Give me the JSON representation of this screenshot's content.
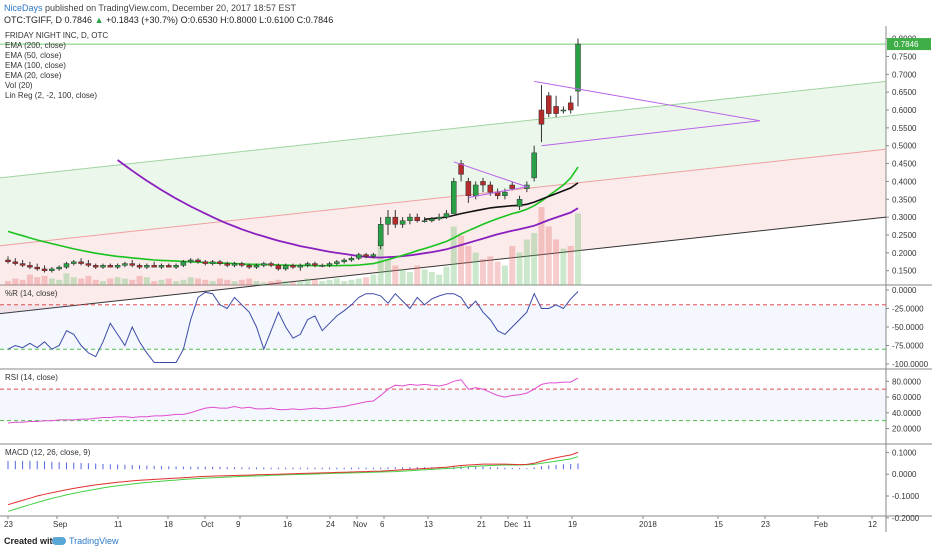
{
  "header": {
    "user": "NiceDays",
    "published": "published on TradingView.com, December 20, 2017 18:57 EST",
    "symbol": "OTC:TGIFF, D",
    "last": "0.7846",
    "change": "+0.1843 (+30.7%)",
    "ohlc": "O:0.6530 H:0.8000 L:0.6100 C:0.7846"
  },
  "legend": {
    "title": "FRIDAY NIGHT INC, D, OTC",
    "lines": [
      "EMA (200, close)",
      "EMA (50, close)",
      "EMA (100, close)",
      "EMA (20, close)",
      "Vol (20)",
      "Lin Reg (2, -2, 100, close)"
    ]
  },
  "price_axis": {
    "ticks": [
      "0.8000",
      "0.7500",
      "0.7000",
      "0.6500",
      "0.6000",
      "0.5500",
      "0.5000",
      "0.4500",
      "0.4000",
      "0.3500",
      "0.3000",
      "0.2500",
      "0.2000",
      "0.1500"
    ],
    "last_badge": "0.7846"
  },
  "panels": {
    "wr": {
      "title": "%R (14, close)",
      "ticks": [
        "0.0000",
        "-25.0000",
        "-50.0000",
        "-75.0000",
        "-100.0000"
      ]
    },
    "rsi": {
      "title": "RSI (14, close)",
      "ticks": [
        "80.0000",
        "60.0000",
        "40.0000",
        "20.0000"
      ]
    },
    "macd": {
      "title": "MACD (12, 26, close, 9)",
      "ticks": [
        "0.1000",
        "0.0000",
        "-0.1000",
        "-0.2000"
      ]
    }
  },
  "time_axis": [
    "23",
    "Sep",
    "11",
    "18",
    "Oct",
    "9",
    "16",
    "24",
    "Nov",
    "6",
    "13",
    "21",
    "Dec",
    "11",
    "19",
    "2018",
    "15",
    "23",
    "Feb",
    "12"
  ],
  "footer": {
    "created": "Created with",
    "brand": "TradingView"
  },
  "colors": {
    "up": "#2aa046",
    "down": "#b52a2a",
    "ema50": "#19c31e",
    "ema100": "#8a1fbf",
    "ema20": "#111111",
    "wr": "#3d4ba8",
    "rsi": "#e14fd0",
    "macd": "#e03030",
    "signal": "#44d044",
    "hist": "#5565e0",
    "badge": "#3fae49"
  },
  "chart_data": {
    "type": "candlestick",
    "title": "FRIDAY NIGHT INC, D, OTC",
    "ylim": [
      0.11,
      0.81
    ],
    "candles": [
      {
        "o": 0.18,
        "h": 0.19,
        "l": 0.17,
        "c": 0.175
      },
      {
        "o": 0.175,
        "h": 0.185,
        "l": 0.165,
        "c": 0.17
      },
      {
        "o": 0.17,
        "h": 0.18,
        "l": 0.16,
        "c": 0.165
      },
      {
        "o": 0.165,
        "h": 0.175,
        "l": 0.155,
        "c": 0.16
      },
      {
        "o": 0.16,
        "h": 0.17,
        "l": 0.15,
        "c": 0.155
      },
      {
        "o": 0.155,
        "h": 0.165,
        "l": 0.145,
        "c": 0.15
      },
      {
        "o": 0.15,
        "h": 0.16,
        "l": 0.145,
        "c": 0.155
      },
      {
        "o": 0.155,
        "h": 0.165,
        "l": 0.15,
        "c": 0.16
      },
      {
        "o": 0.16,
        "h": 0.175,
        "l": 0.155,
        "c": 0.17
      },
      {
        "o": 0.17,
        "h": 0.18,
        "l": 0.165,
        "c": 0.175
      },
      {
        "o": 0.175,
        "h": 0.185,
        "l": 0.165,
        "c": 0.17
      },
      {
        "o": 0.17,
        "h": 0.18,
        "l": 0.16,
        "c": 0.165
      },
      {
        "o": 0.165,
        "h": 0.17,
        "l": 0.155,
        "c": 0.16
      },
      {
        "o": 0.16,
        "h": 0.17,
        "l": 0.155,
        "c": 0.165
      },
      {
        "o": 0.165,
        "h": 0.17,
        "l": 0.16,
        "c": 0.16
      },
      {
        "o": 0.16,
        "h": 0.17,
        "l": 0.155,
        "c": 0.165
      },
      {
        "o": 0.165,
        "h": 0.175,
        "l": 0.16,
        "c": 0.17
      },
      {
        "o": 0.17,
        "h": 0.18,
        "l": 0.16,
        "c": 0.165
      },
      {
        "o": 0.165,
        "h": 0.17,
        "l": 0.155,
        "c": 0.16
      },
      {
        "o": 0.16,
        "h": 0.17,
        "l": 0.155,
        "c": 0.165
      },
      {
        "o": 0.165,
        "h": 0.175,
        "l": 0.16,
        "c": 0.16
      },
      {
        "o": 0.16,
        "h": 0.17,
        "l": 0.155,
        "c": 0.165
      },
      {
        "o": 0.165,
        "h": 0.17,
        "l": 0.16,
        "c": 0.16
      },
      {
        "o": 0.16,
        "h": 0.17,
        "l": 0.155,
        "c": 0.165
      },
      {
        "o": 0.165,
        "h": 0.18,
        "l": 0.16,
        "c": 0.175
      },
      {
        "o": 0.175,
        "h": 0.185,
        "l": 0.17,
        "c": 0.18
      },
      {
        "o": 0.18,
        "h": 0.185,
        "l": 0.17,
        "c": 0.175
      },
      {
        "o": 0.175,
        "h": 0.18,
        "l": 0.165,
        "c": 0.17
      },
      {
        "o": 0.17,
        "h": 0.18,
        "l": 0.165,
        "c": 0.175
      },
      {
        "o": 0.175,
        "h": 0.18,
        "l": 0.165,
        "c": 0.17
      },
      {
        "o": 0.17,
        "h": 0.175,
        "l": 0.16,
        "c": 0.165
      },
      {
        "o": 0.165,
        "h": 0.175,
        "l": 0.16,
        "c": 0.17
      },
      {
        "o": 0.17,
        "h": 0.175,
        "l": 0.16,
        "c": 0.165
      },
      {
        "o": 0.165,
        "h": 0.17,
        "l": 0.155,
        "c": 0.16
      },
      {
        "o": 0.16,
        "h": 0.17,
        "l": 0.155,
        "c": 0.165
      },
      {
        "o": 0.165,
        "h": 0.175,
        "l": 0.16,
        "c": 0.17
      },
      {
        "o": 0.17,
        "h": 0.175,
        "l": 0.16,
        "c": 0.165
      },
      {
        "o": 0.165,
        "h": 0.17,
        "l": 0.15,
        "c": 0.155
      },
      {
        "o": 0.155,
        "h": 0.17,
        "l": 0.15,
        "c": 0.165
      },
      {
        "o": 0.165,
        "h": 0.17,
        "l": 0.155,
        "c": 0.16
      },
      {
        "o": 0.16,
        "h": 0.17,
        "l": 0.15,
        "c": 0.165
      },
      {
        "o": 0.165,
        "h": 0.175,
        "l": 0.16,
        "c": 0.17
      },
      {
        "o": 0.17,
        "h": 0.175,
        "l": 0.16,
        "c": 0.165
      },
      {
        "o": 0.165,
        "h": 0.17,
        "l": 0.16,
        "c": 0.165
      },
      {
        "o": 0.165,
        "h": 0.175,
        "l": 0.16,
        "c": 0.17
      },
      {
        "o": 0.17,
        "h": 0.18,
        "l": 0.165,
        "c": 0.175
      },
      {
        "o": 0.175,
        "h": 0.185,
        "l": 0.17,
        "c": 0.18
      },
      {
        "o": 0.18,
        "h": 0.19,
        "l": 0.175,
        "c": 0.185
      },
      {
        "o": 0.185,
        "h": 0.2,
        "l": 0.18,
        "c": 0.195
      },
      {
        "o": 0.195,
        "h": 0.2,
        "l": 0.185,
        "c": 0.19
      },
      {
        "o": 0.19,
        "h": 0.2,
        "l": 0.185,
        "c": 0.195
      },
      {
        "o": 0.22,
        "h": 0.3,
        "l": 0.21,
        "c": 0.28
      },
      {
        "o": 0.28,
        "h": 0.32,
        "l": 0.25,
        "c": 0.3
      },
      {
        "o": 0.3,
        "h": 0.32,
        "l": 0.27,
        "c": 0.28
      },
      {
        "o": 0.28,
        "h": 0.3,
        "l": 0.27,
        "c": 0.29
      },
      {
        "o": 0.29,
        "h": 0.31,
        "l": 0.28,
        "c": 0.3
      },
      {
        "o": 0.3,
        "h": 0.31,
        "l": 0.285,
        "c": 0.29
      },
      {
        "o": 0.29,
        "h": 0.3,
        "l": 0.285,
        "c": 0.29
      },
      {
        "o": 0.29,
        "h": 0.3,
        "l": 0.285,
        "c": 0.295
      },
      {
        "o": 0.295,
        "h": 0.31,
        "l": 0.29,
        "c": 0.3
      },
      {
        "o": 0.3,
        "h": 0.32,
        "l": 0.295,
        "c": 0.31
      },
      {
        "o": 0.31,
        "h": 0.41,
        "l": 0.31,
        "c": 0.4
      },
      {
        "o": 0.45,
        "h": 0.46,
        "l": 0.4,
        "c": 0.42
      },
      {
        "o": 0.4,
        "h": 0.41,
        "l": 0.34,
        "c": 0.36
      },
      {
        "o": 0.36,
        "h": 0.4,
        "l": 0.35,
        "c": 0.39
      },
      {
        "o": 0.4,
        "h": 0.41,
        "l": 0.37,
        "c": 0.39
      },
      {
        "o": 0.39,
        "h": 0.4,
        "l": 0.36,
        "c": 0.37
      },
      {
        "o": 0.37,
        "h": 0.38,
        "l": 0.35,
        "c": 0.36
      },
      {
        "o": 0.36,
        "h": 0.38,
        "l": 0.35,
        "c": 0.37
      },
      {
        "o": 0.39,
        "h": 0.4,
        "l": 0.375,
        "c": 0.38
      },
      {
        "o": 0.33,
        "h": 0.36,
        "l": 0.32,
        "c": 0.35
      },
      {
        "o": 0.38,
        "h": 0.4,
        "l": 0.37,
        "c": 0.39
      },
      {
        "o": 0.41,
        "h": 0.5,
        "l": 0.4,
        "c": 0.48
      },
      {
        "o": 0.6,
        "h": 0.67,
        "l": 0.51,
        "c": 0.56
      },
      {
        "o": 0.64,
        "h": 0.65,
        "l": 0.58,
        "c": 0.59
      },
      {
        "o": 0.61,
        "h": 0.64,
        "l": 0.58,
        "c": 0.59
      },
      {
        "o": 0.6,
        "h": 0.61,
        "l": 0.59,
        "c": 0.6
      },
      {
        "o": 0.62,
        "h": 0.64,
        "l": 0.59,
        "c": 0.6
      },
      {
        "o": 0.653,
        "h": 0.8,
        "l": 0.61,
        "c": 0.7846
      }
    ],
    "ema50": [
      0.26,
      0.254,
      0.248,
      0.242,
      0.236,
      0.231,
      0.226,
      0.221,
      0.216,
      0.211,
      0.207,
      0.203,
      0.199,
      0.196,
      0.193,
      0.19,
      0.188,
      0.186,
      0.184,
      0.182,
      0.18,
      0.179,
      0.178,
      0.177,
      0.176,
      0.175,
      0.174,
      0.173,
      0.172,
      0.171,
      0.171,
      0.17,
      0.169,
      0.168,
      0.168,
      0.167,
      0.167,
      0.166,
      0.166,
      0.165,
      0.165,
      0.165,
      0.164,
      0.164,
      0.164,
      0.164,
      0.165,
      0.165,
      0.166,
      0.168,
      0.17,
      0.175,
      0.181,
      0.187,
      0.193,
      0.199,
      0.206,
      0.212,
      0.218,
      0.225,
      0.232,
      0.242,
      0.253,
      0.262,
      0.271,
      0.28,
      0.288,
      0.296,
      0.303,
      0.31,
      0.315,
      0.322,
      0.332,
      0.345,
      0.36,
      0.375,
      0.39,
      0.41,
      0.44
    ],
    "ema100": [
      null,
      null,
      null,
      null,
      null,
      null,
      null,
      null,
      null,
      null,
      null,
      null,
      null,
      null,
      null,
      0.46,
      0.445,
      0.43,
      0.416,
      0.402,
      0.389,
      0.376,
      0.364,
      0.352,
      0.341,
      0.33,
      0.32,
      0.31,
      0.3,
      0.291,
      0.282,
      0.274,
      0.266,
      0.259,
      0.252,
      0.246,
      0.24,
      0.234,
      0.229,
      0.224,
      0.219,
      0.215,
      0.211,
      0.207,
      0.203,
      0.2,
      0.197,
      0.194,
      0.191,
      0.189,
      0.187,
      0.187,
      0.188,
      0.189,
      0.191,
      0.193,
      0.196,
      0.199,
      0.202,
      0.206,
      0.21,
      0.216,
      0.222,
      0.228,
      0.234,
      0.24,
      0.246,
      0.252,
      0.257,
      0.262,
      0.266,
      0.271,
      0.276,
      0.284,
      0.292,
      0.299,
      0.306,
      0.313,
      0.325
    ],
    "ema20": [
      null,
      null,
      null,
      null,
      null,
      null,
      null,
      null,
      null,
      null,
      null,
      null,
      null,
      null,
      null,
      null,
      null,
      null,
      null,
      null,
      null,
      null,
      null,
      null,
      null,
      null,
      null,
      null,
      null,
      null,
      null,
      null,
      null,
      null,
      null,
      null,
      null,
      null,
      null,
      null,
      null,
      null,
      null,
      null,
      null,
      null,
      null,
      null,
      null,
      null,
      null,
      null,
      null,
      null,
      null,
      null,
      null,
      0.294,
      0.296,
      0.298,
      0.3,
      0.305,
      0.31,
      0.314,
      0.318,
      0.322,
      0.326,
      0.328,
      0.33,
      0.332,
      0.333,
      0.336,
      0.342,
      0.35,
      0.358,
      0.366,
      0.374,
      0.382,
      0.396
    ],
    "wr": [
      -80,
      -75,
      -78,
      -72,
      -78,
      -70,
      -80,
      -75,
      -55,
      -60,
      -75,
      -85,
      -90,
      -70,
      -45,
      -60,
      -75,
      -50,
      -70,
      -85,
      -98,
      -98,
      -98,
      -98,
      -80,
      -40,
      -10,
      -3,
      -5,
      -20,
      -25,
      -10,
      -20,
      -30,
      -50,
      -80,
      -55,
      -30,
      -50,
      -65,
      -60,
      -40,
      -35,
      -55,
      -45,
      -35,
      -28,
      -20,
      -10,
      -5,
      -5,
      -8,
      -18,
      -5,
      -15,
      -25,
      -10,
      -20,
      -12,
      -8,
      -5,
      -5,
      -10,
      -25,
      -15,
      -30,
      -40,
      -55,
      -60,
      -50,
      -40,
      -30,
      -5,
      -25,
      -25,
      -20,
      -25,
      -12,
      -2
    ],
    "rsi": [
      27,
      28,
      28,
      29,
      29,
      30,
      30,
      31,
      31,
      31,
      32,
      32,
      33,
      34,
      34,
      35,
      35,
      34,
      35,
      35,
      36,
      36,
      37,
      38,
      38,
      40,
      43,
      46,
      47,
      46,
      46,
      48,
      46,
      47,
      45,
      45,
      46,
      44,
      44,
      45,
      44,
      45,
      46,
      45,
      46,
      47,
      48,
      50,
      52,
      54,
      55,
      62,
      70,
      75,
      74,
      76,
      75,
      76,
      75,
      74,
      76,
      80,
      82,
      70,
      72,
      70,
      66,
      62,
      60,
      62,
      63,
      65,
      70,
      76,
      78,
      78,
      79,
      79,
      84
    ],
    "macd": [
      -0.14,
      -0.13,
      -0.12,
      -0.11,
      -0.1,
      -0.092,
      -0.085,
      -0.078,
      -0.071,
      -0.065,
      -0.059,
      -0.054,
      -0.049,
      -0.045,
      -0.041,
      -0.037,
      -0.034,
      -0.031,
      -0.028,
      -0.026,
      -0.024,
      -0.022,
      -0.02,
      -0.018,
      -0.016,
      -0.014,
      -0.012,
      -0.01,
      -0.009,
      -0.008,
      -0.007,
      -0.006,
      -0.005,
      -0.004,
      -0.003,
      -0.002,
      -0.001,
      0.0,
      0.001,
      0.002,
      0.003,
      0.004,
      0.005,
      0.006,
      0.007,
      0.008,
      0.009,
      0.01,
      0.011,
      0.012,
      0.013,
      0.014,
      0.016,
      0.018,
      0.02,
      0.022,
      0.024,
      0.026,
      0.028,
      0.03,
      0.032,
      0.036,
      0.04,
      0.042,
      0.044,
      0.046,
      0.046,
      0.046,
      0.046,
      0.045,
      0.044,
      0.045,
      0.05,
      0.06,
      0.068,
      0.075,
      0.082,
      0.088,
      0.1
    ],
    "signal": [
      -0.17,
      -0.16,
      -0.15,
      -0.14,
      -0.13,
      -0.12,
      -0.111,
      -0.103,
      -0.095,
      -0.088,
      -0.081,
      -0.075,
      -0.069,
      -0.063,
      -0.058,
      -0.053,
      -0.049,
      -0.045,
      -0.041,
      -0.038,
      -0.035,
      -0.032,
      -0.029,
      -0.027,
      -0.024,
      -0.022,
      -0.02,
      -0.018,
      -0.016,
      -0.015,
      -0.013,
      -0.012,
      -0.01,
      -0.009,
      -0.008,
      -0.007,
      -0.005,
      -0.004,
      -0.003,
      -0.002,
      -0.001,
      0.0,
      0.001,
      0.002,
      0.003,
      0.004,
      0.005,
      0.006,
      0.007,
      0.008,
      0.009,
      0.01,
      0.011,
      0.012,
      0.014,
      0.016,
      0.018,
      0.02,
      0.022,
      0.024,
      0.026,
      0.028,
      0.031,
      0.034,
      0.036,
      0.038,
      0.04,
      0.041,
      0.042,
      0.042,
      0.042,
      0.043,
      0.045,
      0.05,
      0.055,
      0.06,
      0.065,
      0.07,
      0.08
    ],
    "volume": [
      0.03,
      0.05,
      0.04,
      0.08,
      0.06,
      0.07,
      0.05,
      0.04,
      0.09,
      0.06,
      0.05,
      0.07,
      0.04,
      0.03,
      0.05,
      0.06,
      0.05,
      0.04,
      0.07,
      0.06,
      0.03,
      0.04,
      0.05,
      0.03,
      0.04,
      0.06,
      0.05,
      0.04,
      0.03,
      0.05,
      0.04,
      0.03,
      0.04,
      0.05,
      0.03,
      0.02,
      0.03,
      0.04,
      0.03,
      0.02,
      0.03,
      0.05,
      0.04,
      0.03,
      0.04,
      0.05,
      0.03,
      0.04,
      0.05,
      0.06,
      0.08,
      0.35,
      0.2,
      0.15,
      0.12,
      0.1,
      0.15,
      0.12,
      0.1,
      0.08,
      0.14,
      0.45,
      0.38,
      0.3,
      0.25,
      0.2,
      0.22,
      0.18,
      0.15,
      0.3,
      0.25,
      0.35,
      0.4,
      0.6,
      0.45,
      0.35,
      0.28,
      0.3,
      0.55
    ]
  }
}
